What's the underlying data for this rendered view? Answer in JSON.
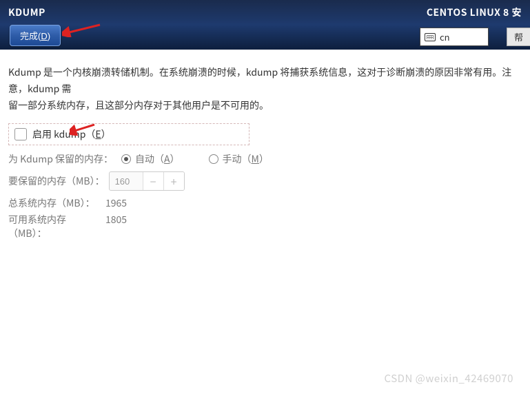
{
  "header": {
    "title": "KDUMP",
    "distro": "CENTOS LINUX 8 安",
    "done_label": "完成(",
    "done_key": "D",
    "done_suffix": ")",
    "lang_code": "cn",
    "help_label": "帮"
  },
  "body": {
    "desc_line1": "Kdump 是一个内核崩溃转储机制。在系统崩溃的时候，kdump 将捕获系统信息，这对于诊断崩溃的原因非常有用。注意，kdump 需",
    "desc_line2": "留一部分系统内存，且这部分内存对于其他用户是不可用的。",
    "enable_label": "启用 kdump（",
    "enable_key": "E",
    "enable_suffix": "）",
    "reserve_label": "为 Kdump 保留的内存：",
    "auto_label": "自动（",
    "auto_key": "A",
    "auto_suffix": "）",
    "manual_label": "手动（",
    "manual_key": "M",
    "manual_suffix": "）",
    "mem_reserve_label": "要保留的内存（MB）：",
    "mem_reserve_value": "160",
    "total_label": "总系统内存（MB）：",
    "total_value": "1965",
    "usable_label": "可用系统内存（MB）：",
    "usable_value": "1805"
  },
  "watermark": "CSDN @weixin_42469070"
}
